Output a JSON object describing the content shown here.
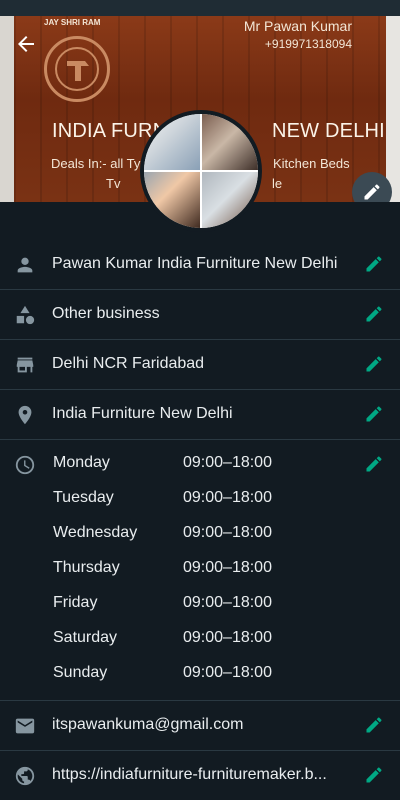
{
  "cover": {
    "slogan": "JAY SHRI RAM",
    "owner": "Mr Pawan Kumar",
    "phone": "+919971318094",
    "shop_left": "INDIA FURN",
    "shop_right": "NEW DELHI",
    "deals_left": "Deals In:- all Ty",
    "deals_right": "Kitchen Beds",
    "line3_left": "Tv",
    "line3_right": "le"
  },
  "profile": {
    "name": "Pawan Kumar India Furniture New Delhi",
    "category": "Other business",
    "area": "Delhi NCR Faridabad",
    "address": "India Furniture New Delhi"
  },
  "hours": [
    {
      "day": "Monday",
      "time": "09:00–18:00"
    },
    {
      "day": "Tuesday",
      "time": "09:00–18:00"
    },
    {
      "day": "Wednesday",
      "time": "09:00–18:00"
    },
    {
      "day": "Thursday",
      "time": "09:00–18:00"
    },
    {
      "day": "Friday",
      "time": "09:00–18:00"
    },
    {
      "day": "Saturday",
      "time": "09:00–18:00"
    },
    {
      "day": "Sunday",
      "time": "09:00–18:00"
    }
  ],
  "contact": {
    "email": "itspawankuma@gmail.com",
    "website": "https://indiafurniture-furnituremaker.b..."
  },
  "icons": {
    "back": "back-arrow-icon",
    "edit": "pencil-icon",
    "person": "person-icon",
    "category": "shapes-icon",
    "store": "store-icon",
    "location": "location-pin-icon",
    "clock": "clock-icon",
    "email": "email-icon",
    "web": "globe-icon"
  },
  "colors": {
    "background": "#121b22",
    "accent": "#00a884",
    "icon": "#8696a0",
    "text": "#e9edef"
  }
}
